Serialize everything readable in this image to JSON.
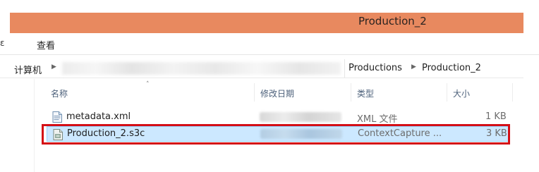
{
  "window": {
    "title": "Production_2"
  },
  "ribbon": {
    "file_tab": "ε",
    "view_tab": "查看"
  },
  "address": {
    "computer": "计算机",
    "segments": [
      "Productions",
      "Production_2"
    ]
  },
  "columns": {
    "name": "名称",
    "date": "修改日期",
    "type": "类型",
    "size": "大小"
  },
  "files": [
    {
      "name": "metadata.xml",
      "type": "XML 文件",
      "size": "1 KB",
      "icon": "xml-file-icon"
    },
    {
      "name": "Production_2.s3c",
      "type": "ContextCapture ...",
      "size": "3 KB",
      "icon": "s3c-file-icon",
      "selected": true
    }
  ],
  "colors": {
    "titlebar": "#e8895f",
    "selection": "#cce8ff",
    "highlight": "#d40f16"
  }
}
